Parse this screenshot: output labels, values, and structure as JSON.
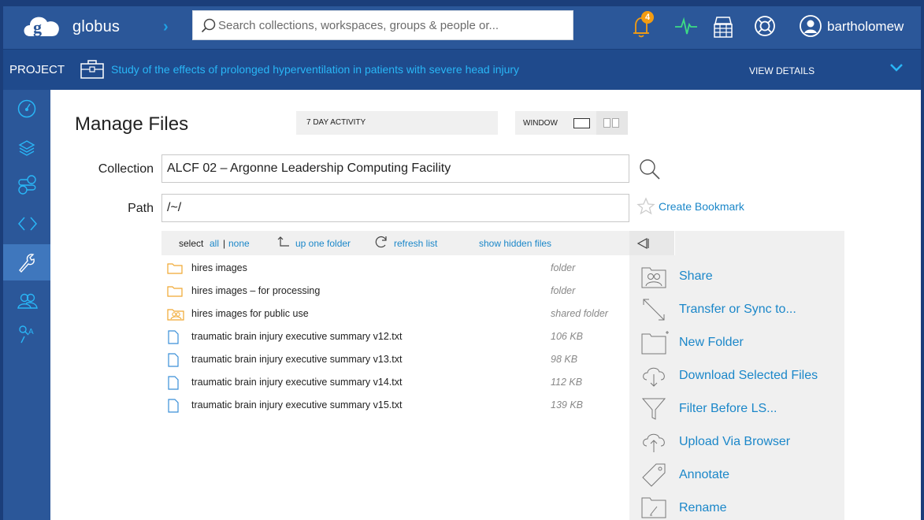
{
  "app": {
    "brand": "globus",
    "username": "bartholomew",
    "notification_count": "4"
  },
  "search": {
    "placeholder": "Search collections, workspaces, groups & people or..."
  },
  "project": {
    "label": "PROJECT",
    "title": "Study of the effects of prolonged hyperventilation in patients with severe head injury",
    "view_details": "VIEW DETAILS"
  },
  "sidebar": {
    "items": [
      {
        "icon": "dashboard-icon",
        "active": false
      },
      {
        "icon": "layers-icon",
        "active": false
      },
      {
        "icon": "flows-icon",
        "active": false
      },
      {
        "icon": "code-icon",
        "active": false
      },
      {
        "icon": "wrench-icon",
        "active": true
      },
      {
        "icon": "groups-icon",
        "active": false
      },
      {
        "icon": "search-user-icon",
        "active": false
      }
    ]
  },
  "main": {
    "title": "Manage Files",
    "activity_label": "7 DAY ACTIVITY",
    "window_label": "WINDOW",
    "collection_label": "Collection",
    "collection_value": "ALCF 02 – Argonne Leadership Computing Facility",
    "path_label": "Path",
    "path_value": "/~/",
    "create_bookmark": "Create Bookmark"
  },
  "list_header": {
    "select": "select",
    "all": "all",
    "separator": "|",
    "none": "none",
    "up_folder": "up one folder",
    "refresh": "refresh list",
    "show_hidden": "show hidden files"
  },
  "files": [
    {
      "name": "hires images",
      "info": "folder",
      "kind": "folder-icon"
    },
    {
      "name": "hires images – for processing",
      "info": "folder",
      "kind": "folder-icon"
    },
    {
      "name": "hires images for public use",
      "info": "shared folder",
      "kind": "shared-folder-icon"
    },
    {
      "name": "traumatic brain injury executive summary v12.txt",
      "info": "106 KB",
      "kind": "file-icon"
    },
    {
      "name": "traumatic brain injury executive summary v13.txt",
      "info": "98 KB",
      "kind": "file-icon"
    },
    {
      "name": "traumatic brain injury executive summary v14.txt",
      "info": "112 KB",
      "kind": "file-icon"
    },
    {
      "name": "traumatic brain injury executive summary v15.txt",
      "info": "139 KB",
      "kind": "file-icon"
    }
  ],
  "actions": [
    {
      "label": "Share",
      "icon": "share-icon"
    },
    {
      "label": "Transfer or Sync to...",
      "icon": "transfer-icon"
    },
    {
      "label": "New Folder",
      "icon": "new-folder-icon"
    },
    {
      "label": "Download Selected Files",
      "icon": "download-icon"
    },
    {
      "label": "Filter Before LS...",
      "icon": "filter-icon"
    },
    {
      "label": "Upload Via Browser",
      "icon": "upload-icon"
    },
    {
      "label": "Annotate",
      "icon": "tag-icon"
    },
    {
      "label": "Rename",
      "icon": "rename-icon"
    }
  ],
  "colors": {
    "accent": "#1b87c9",
    "topbar": "#2b5799",
    "badge": "#f39c12",
    "activity": "#3ddc84"
  }
}
